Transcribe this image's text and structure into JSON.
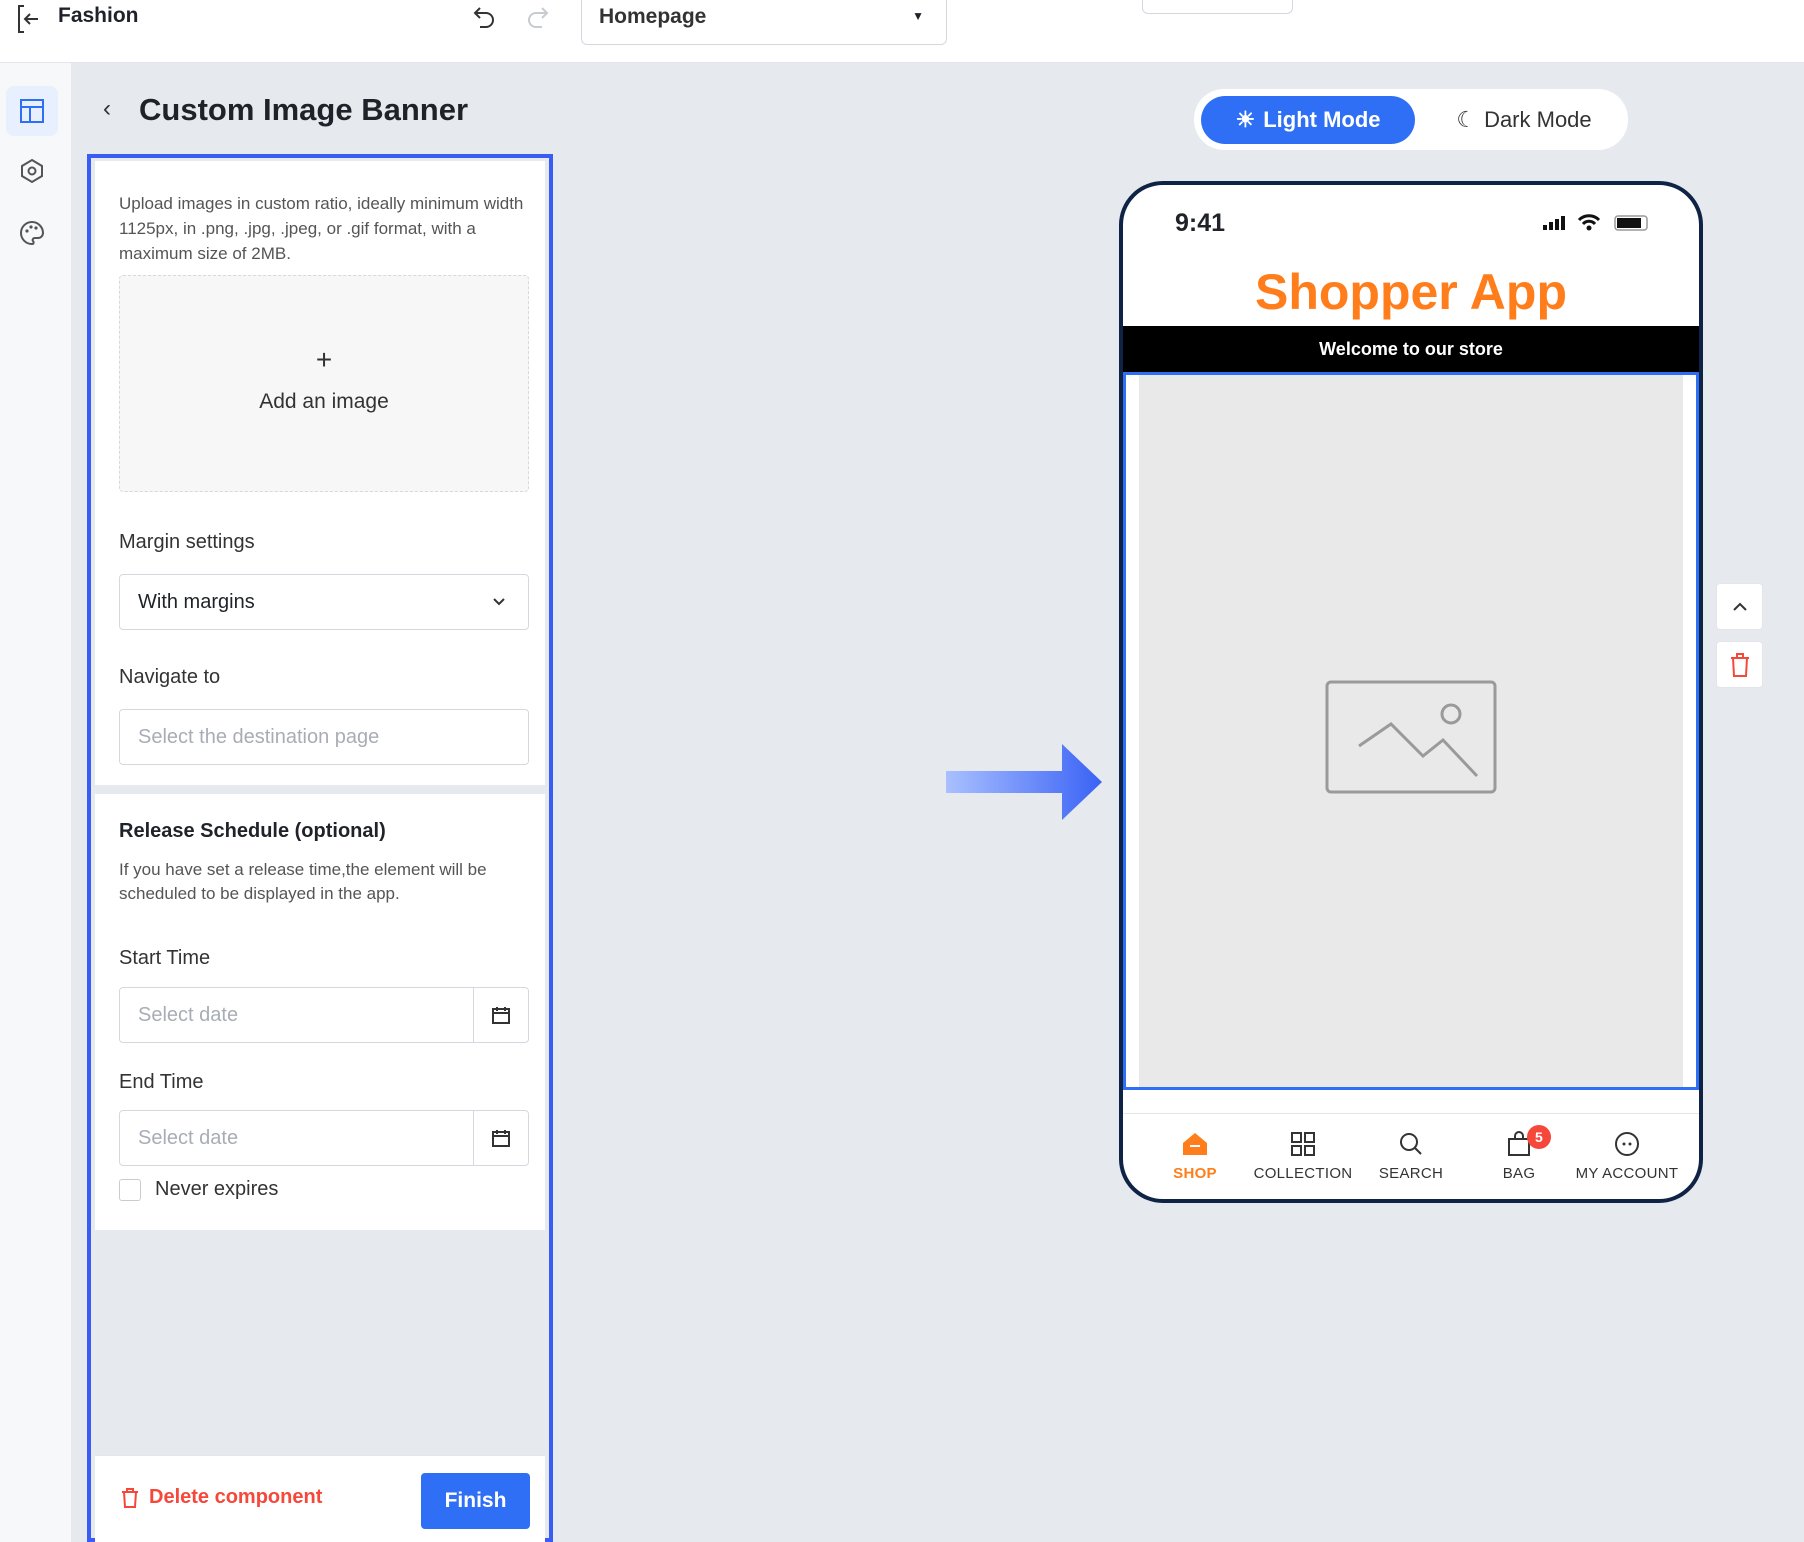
{
  "topbar": {
    "app_name": "Fashion",
    "page_select": "Homepage"
  },
  "panel": {
    "title": "Custom Image Banner",
    "upload_hint": "Upload images in custom ratio, ideally minimum width 1125px, in .png, .jpg, .jpeg, or .gif format, with a maximum size of 2MB.",
    "add_image": "Add an image",
    "margin_label": "Margin settings",
    "margin_value": "With margins",
    "navigate_label": "Navigate to",
    "navigate_placeholder": "Select the destination page",
    "release_title": "Release Schedule (optional)",
    "release_desc": "If you have set a release time,the element will be scheduled to be displayed in the app.",
    "start_label": "Start Time",
    "start_placeholder": "Select date",
    "end_label": "End Time",
    "end_placeholder": "Select date",
    "never_expires": "Never expires",
    "delete_label": "Delete component",
    "finish_label": "Finish"
  },
  "preview": {
    "light_mode": "Light Mode",
    "dark_mode": "Dark Mode",
    "time": "9:41",
    "app_title": "Shopper App",
    "welcome": "Welcome to our store",
    "tabs": [
      "SHOP",
      "COLLECTION",
      "SEARCH",
      "BAG",
      "MY ACCOUNT"
    ],
    "bag_badge": "5"
  },
  "colors": {
    "accent": "#2f6ff5",
    "brand": "#ff7d1a",
    "danger": "#f5483b"
  }
}
